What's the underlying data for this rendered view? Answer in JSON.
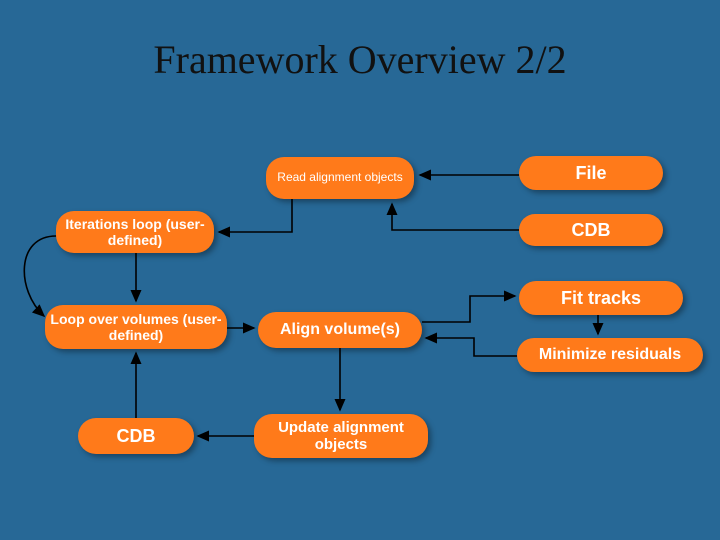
{
  "title": "Framework Overview 2/2",
  "nodes": {
    "read_alignment": "Read alignment objects",
    "file": "File",
    "iterations": "Iterations loop (user-defined)",
    "cdb_top": "CDB",
    "loop_volumes": "Loop over volumes (user-defined)",
    "align_volumes": "Align volume(s)",
    "fit_tracks": "Fit tracks",
    "minimize": "Minimize residuals",
    "cdb_bottom": "CDB",
    "update_alignment": "Update alignment objects"
  }
}
